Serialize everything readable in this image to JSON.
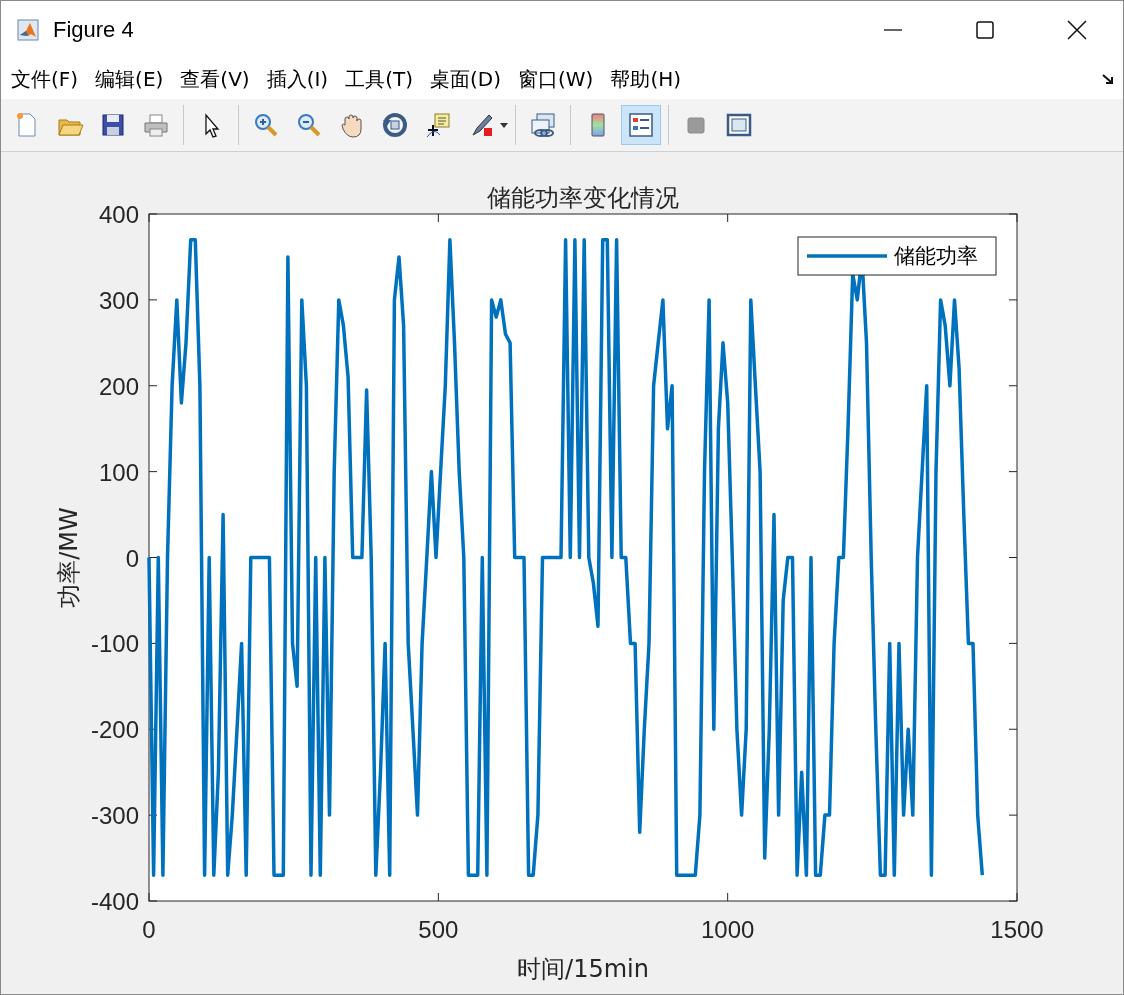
{
  "window": {
    "title": "Figure 4"
  },
  "menu": [
    "文件(F)",
    "编辑(E)",
    "查看(V)",
    "插入(I)",
    "工具(T)",
    "桌面(D)",
    "窗口(W)",
    "帮助(H)"
  ],
  "toolbar": [
    {
      "kind": "new",
      "pressed": false
    },
    {
      "kind": "open",
      "pressed": false
    },
    {
      "kind": "save",
      "pressed": false
    },
    {
      "kind": "print",
      "pressed": false
    },
    {
      "kind": "sep"
    },
    {
      "kind": "pointer",
      "pressed": false
    },
    {
      "kind": "sep"
    },
    {
      "kind": "zoomin",
      "pressed": false
    },
    {
      "kind": "zoomout",
      "pressed": false
    },
    {
      "kind": "pan",
      "pressed": false
    },
    {
      "kind": "rotate",
      "pressed": false
    },
    {
      "kind": "datatip",
      "pressed": false
    },
    {
      "kind": "brush",
      "pressed": false
    },
    {
      "kind": "sep"
    },
    {
      "kind": "link",
      "pressed": false
    },
    {
      "kind": "sep"
    },
    {
      "kind": "colorbar",
      "pressed": false
    },
    {
      "kind": "legend",
      "pressed": true
    },
    {
      "kind": "sep"
    },
    {
      "kind": "hide",
      "pressed": false
    },
    {
      "kind": "dock",
      "pressed": false
    }
  ],
  "figure": {
    "chart_data": {
      "type": "line",
      "title": "储能功率变化情况",
      "xlabel": "时间/15min",
      "ylabel": "功率/MW",
      "x": [
        0,
        8,
        16,
        24,
        32,
        40,
        48,
        56,
        64,
        72,
        80,
        88,
        96,
        104,
        112,
        120,
        128,
        136,
        144,
        152,
        160,
        168,
        176,
        184,
        192,
        200,
        208,
        216,
        224,
        232,
        240,
        248,
        256,
        264,
        272,
        280,
        288,
        296,
        304,
        312,
        320,
        328,
        336,
        344,
        352,
        360,
        368,
        376,
        384,
        392,
        400,
        408,
        416,
        424,
        432,
        440,
        448,
        456,
        464,
        472,
        480,
        488,
        496,
        504,
        512,
        520,
        528,
        536,
        544,
        552,
        560,
        568,
        576,
        584,
        592,
        600,
        608,
        616,
        624,
        632,
        640,
        648,
        656,
        664,
        672,
        680,
        688,
        696,
        704,
        712,
        720,
        728,
        736,
        744,
        752,
        760,
        768,
        776,
        784,
        792,
        800,
        808,
        816,
        824,
        832,
        840,
        848,
        856,
        864,
        872,
        880,
        888,
        896,
        904,
        912,
        920,
        928,
        936,
        944,
        952,
        960,
        968,
        976,
        984,
        992,
        1000,
        1008,
        1016,
        1024,
        1032,
        1040,
        1048,
        1056,
        1064,
        1072,
        1080,
        1088,
        1096,
        1104,
        1112,
        1120,
        1128,
        1136,
        1144,
        1152,
        1160,
        1168,
        1176,
        1184,
        1192,
        1200,
        1208,
        1216,
        1224,
        1232,
        1240,
        1248,
        1256,
        1264,
        1272,
        1280,
        1288,
        1296,
        1304,
        1312,
        1320,
        1328,
        1336,
        1344,
        1352,
        1360,
        1368,
        1376,
        1384,
        1392,
        1400,
        1408,
        1416,
        1424,
        1432,
        1440
      ],
      "series": [
        {
          "name": "储能功率",
          "color": "#0072bd",
          "values": [
            0,
            -370,
            0,
            -370,
            0,
            200,
            300,
            180,
            250,
            370,
            370,
            200,
            -370,
            0,
            -370,
            -250,
            50,
            -370,
            -300,
            -200,
            -100,
            -370,
            0,
            0,
            0,
            0,
            0,
            -370,
            -370,
            -370,
            350,
            -100,
            -150,
            300,
            200,
            -370,
            0,
            -370,
            0,
            -300,
            100,
            300,
            270,
            210,
            0,
            0,
            0,
            195,
            0,
            -370,
            -250,
            -100,
            -370,
            300,
            350,
            270,
            -100,
            -200,
            -300,
            -100,
            0,
            100,
            0,
            100,
            200,
            370,
            250,
            100,
            0,
            -370,
            -370,
            -370,
            0,
            -370,
            300,
            280,
            300,
            260,
            250,
            0,
            0,
            0,
            -370,
            -370,
            -300,
            0,
            0,
            0,
            0,
            0,
            370,
            0,
            370,
            0,
            370,
            0,
            -30,
            -80,
            370,
            370,
            0,
            370,
            0,
            0,
            -100,
            -100,
            -320,
            -200,
            -100,
            200,
            250,
            300,
            150,
            200,
            -370,
            -370,
            -370,
            -370,
            -370,
            -300,
            100,
            300,
            -200,
            150,
            250,
            180,
            0,
            -200,
            -300,
            -200,
            300,
            200,
            100,
            -350,
            -200,
            50,
            -300,
            -50,
            0,
            0,
            -370,
            -250,
            -370,
            0,
            -370,
            -370,
            -300,
            -300,
            -100,
            0,
            0,
            150,
            330,
            300,
            350,
            250,
            0,
            -200,
            -370,
            -370,
            -100,
            -370,
            -100,
            -300,
            -200,
            -300,
            0,
            100,
            200,
            -370,
            100,
            300,
            270,
            200,
            300,
            220,
            50,
            -100,
            -100,
            -300,
            -370
          ]
        }
      ],
      "xlim": [
        0,
        1500
      ],
      "ylim": [
        -400,
        400
      ],
      "xticks": [
        0,
        500,
        1000,
        1500
      ],
      "yticks": [
        -400,
        -300,
        -200,
        -100,
        0,
        100,
        200,
        300,
        400
      ]
    }
  }
}
